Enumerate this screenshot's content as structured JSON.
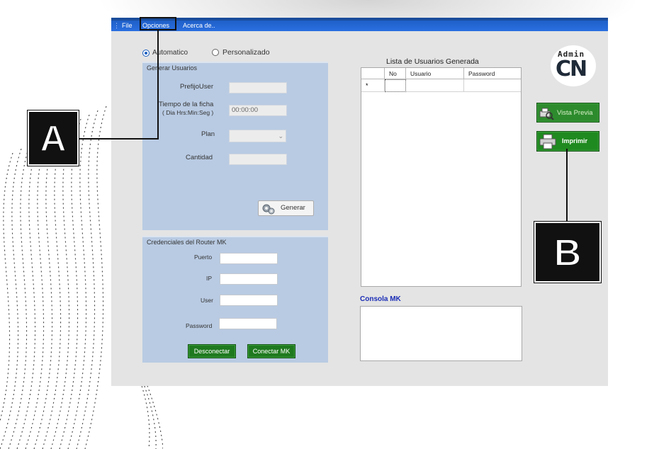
{
  "window": {
    "menu": {
      "grip": "⋮",
      "items": [
        "File",
        "Opciones",
        "Acerca de.."
      ]
    },
    "mode": {
      "auto_label": "Automatico",
      "custom_label": "Personalizado",
      "selected": "Automatico"
    },
    "generate": {
      "legend": "Generar Usuarios",
      "prefix_label": "PrefijoUser",
      "time_label_line1": "Tiempo de la ficha",
      "time_label_line2": "( Dia Hrs:Min:Seg )",
      "time_value": "00:00:00",
      "plan_label": "Plan",
      "quantity_label": "Cantidad",
      "generate_button": "Generar"
    },
    "router": {
      "legend": "Credenciales del Router MK",
      "port_label": "Puerto",
      "ip_label": "IP",
      "user_label": "User",
      "password_label": "Password",
      "disconnect_button": "Desconectar",
      "connect_button": "Conectar MK"
    },
    "users_list": {
      "title": "Lista de Usuarios Generada",
      "columns": [
        "No",
        "Usuario",
        "Password"
      ],
      "new_row_marker": "*"
    },
    "console": {
      "title": "Consola MK"
    },
    "logo": {
      "line1": "Admin",
      "line2": "CN"
    },
    "actions": {
      "preview_button": "Vista Previa",
      "print_button": "Imprimir"
    }
  },
  "callouts": {
    "a": "A",
    "b": "B"
  },
  "colors": {
    "menubar": "#2a6fe0",
    "panel": "#b9cbe3",
    "green_button": "#1f7a1f",
    "console_title": "#1a2db5",
    "callout": "#111111"
  }
}
